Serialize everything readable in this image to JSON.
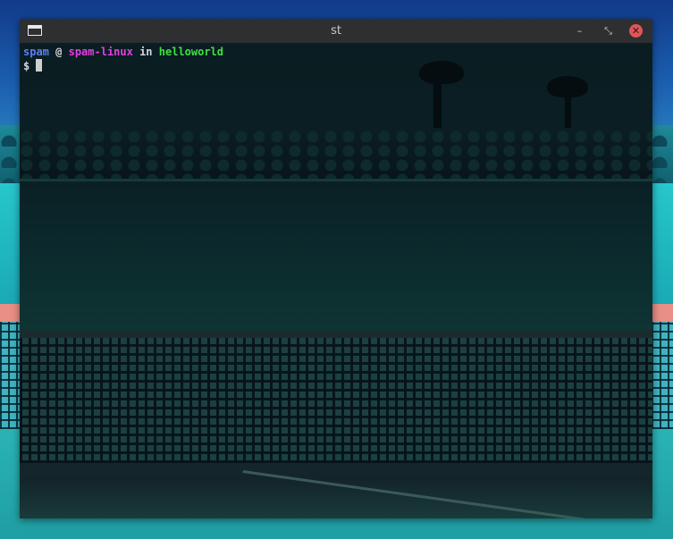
{
  "window": {
    "title": "st",
    "icons": {
      "app": "terminal-window-icon",
      "minimize": "minimize-icon",
      "maximize": "restore-icon",
      "close": "close-icon"
    },
    "minimize_glyph": "–",
    "maximize_glyph": "⤡",
    "close_glyph": "✕"
  },
  "terminal": {
    "prompt": {
      "user": "spam",
      "at": " @ ",
      "host": "spam-linux",
      "in": " in ",
      "directory": "helloworld"
    },
    "input_prefix": "$"
  },
  "colors": {
    "user": "#5a7ff2",
    "host": "#e040e0",
    "directory": "#3fe23f",
    "close_button": "#e0555a"
  }
}
